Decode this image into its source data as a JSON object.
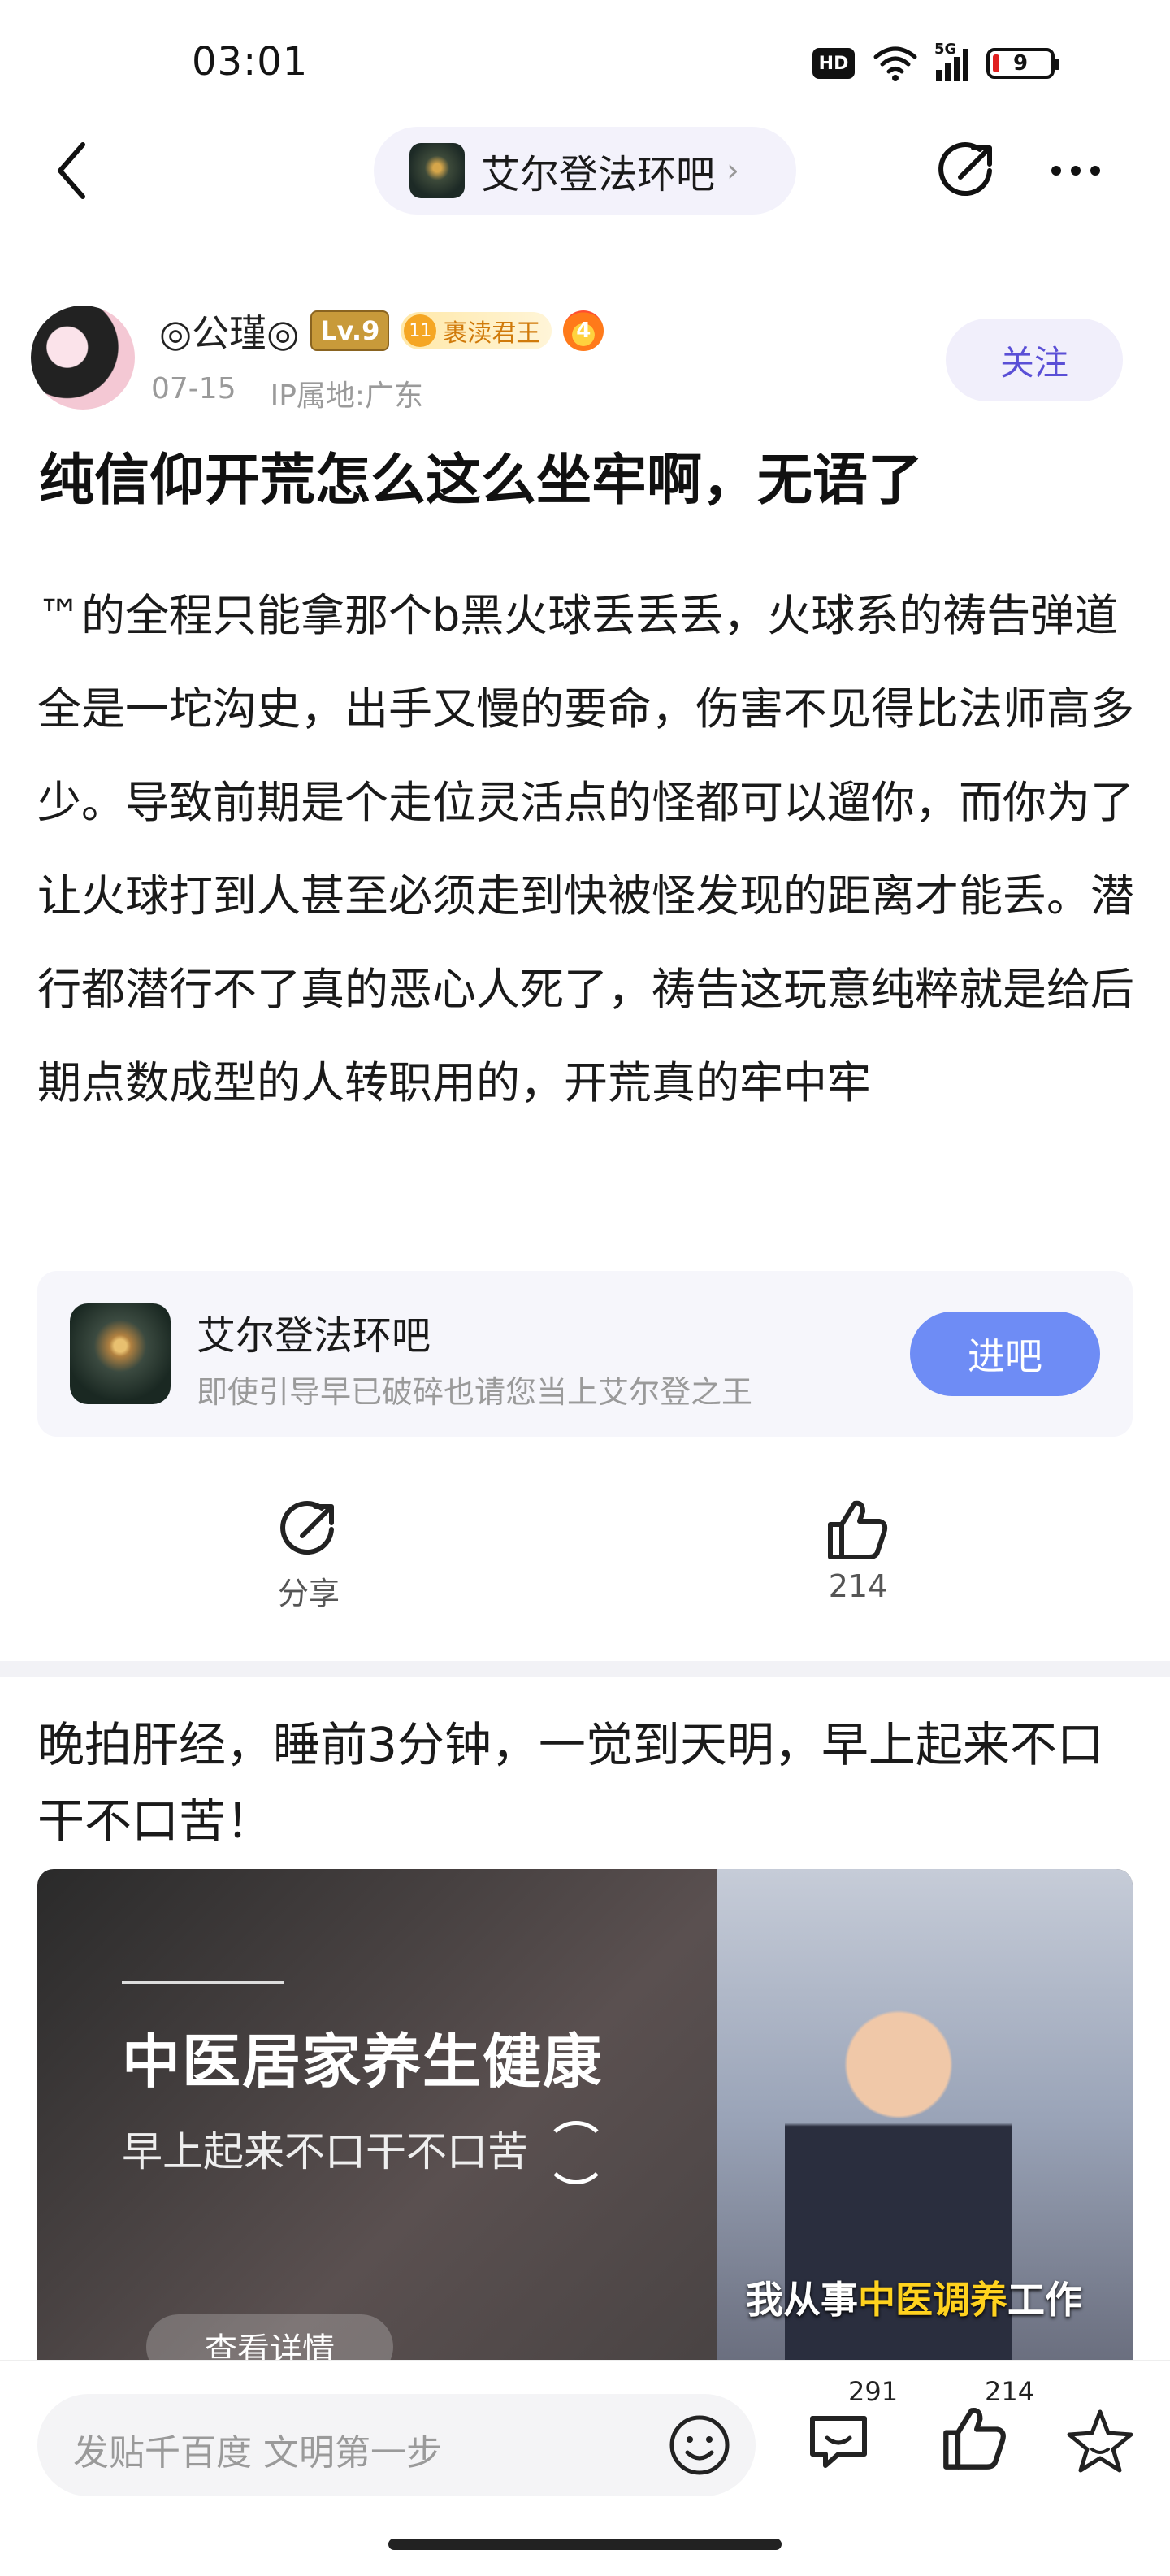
{
  "status_bar": {
    "time": "03:01",
    "hd_label": "HD",
    "network": "5G",
    "battery": "9"
  },
  "nav": {
    "forum_name": "艾尔登法环吧",
    "chevron": "›"
  },
  "author": {
    "name": "◎公瑾◎",
    "level": "Lv.9",
    "title_level": "11",
    "title": "裹渎君王",
    "fire_badge": "4",
    "date": "07-15",
    "ip_location": "IP属地:广东",
    "follow_label": "关注"
  },
  "post": {
    "title": "纯信仰开荒怎么这么坐牢啊，无语了",
    "body": "™的全程只能拿那个b黑火球丢丢丢，火球系的祷告弹道全是一坨沟史，出手又慢的要命，伤害不见得比法师高多少。导致前期是个走位灵活点的怪都可以遛你，而你为了让火球打到人甚至必须走到快被怪发现的距离才能丢。潜行都潜行不了真的恶心人死了，祷告这玩意纯粹就是给后期点数成型的人转职用的，开荒真的牢中牢"
  },
  "forum_card": {
    "name": "艾尔登法环吧",
    "slogan": "即使引导早已破碎也请您当上艾尔登之王",
    "enter_label": "进吧"
  },
  "actions": {
    "share_label": "分享",
    "like_count": "214"
  },
  "ad": {
    "text": "晚拍肝经，睡前3分钟，一觉到天明，早上起来不口干不口苦！",
    "image_title": "中医居家养生健康",
    "image_subtitle": "早上起来不口干不口苦",
    "caption_prefix": "我从事",
    "caption_highlight": "中医调养",
    "caption_suffix": "工作",
    "detail_label": "查看详情"
  },
  "bottom_bar": {
    "input_placeholder": "发贴千百度 文明第一步",
    "comment_count": "291",
    "like_count": "214"
  }
}
